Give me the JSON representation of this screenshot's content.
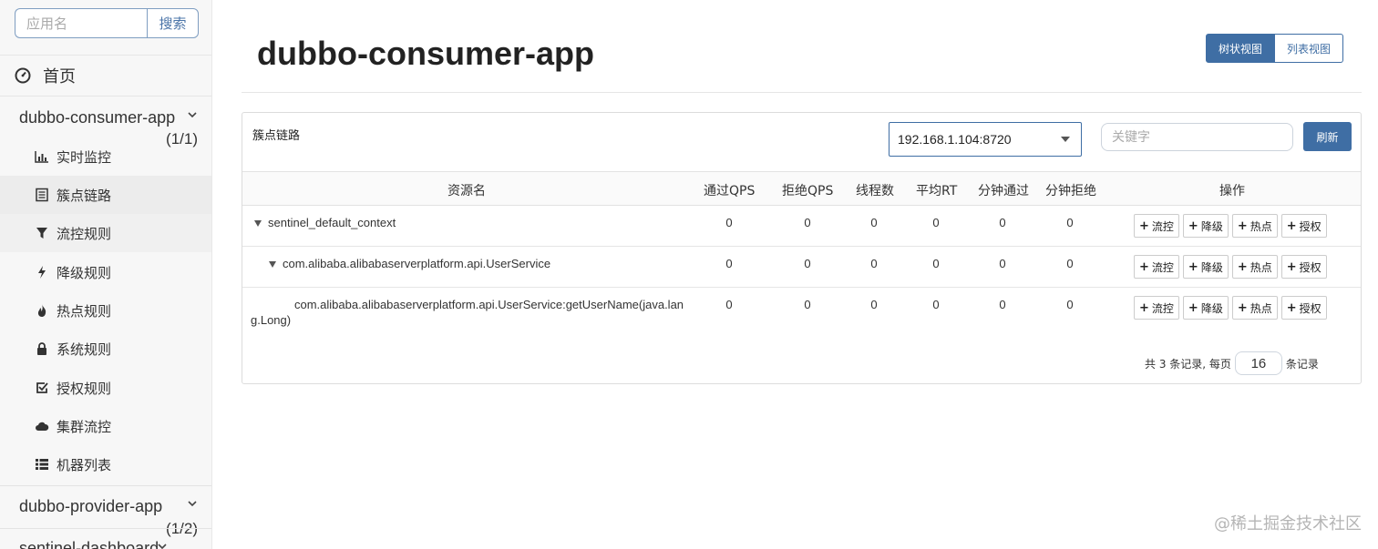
{
  "sidebar": {
    "search": {
      "placeholder": "应用名",
      "button_label": "搜索"
    },
    "home_label": "首页",
    "apps": [
      {
        "name": "dubbo-consumer-app",
        "count": "(1/1)"
      },
      {
        "name": "dubbo-provider-app",
        "count": "(1/2)"
      },
      {
        "name": "sentinel-dashboard"
      }
    ],
    "menu": [
      {
        "label": "实时监控",
        "icon": "bar-chart-icon"
      },
      {
        "label": "簇点链路",
        "icon": "list-icon"
      },
      {
        "label": "流控规则",
        "icon": "filter-icon"
      },
      {
        "label": "降级规则",
        "icon": "bolt-icon"
      },
      {
        "label": "热点规则",
        "icon": "fire-icon"
      },
      {
        "label": "系统规则",
        "icon": "lock-icon"
      },
      {
        "label": "授权规则",
        "icon": "check-icon"
      },
      {
        "label": "集群流控",
        "icon": "cloud-icon"
      },
      {
        "label": "机器列表",
        "icon": "th-list-icon"
      }
    ]
  },
  "main": {
    "title": "dubbo-consumer-app",
    "view_toggle": {
      "tree": "树状视图",
      "list": "列表视图"
    },
    "panel_label": "簇点链路",
    "machine": "192.168.1.104:8720",
    "keyword_placeholder": "关键字",
    "refresh_label": "刷新",
    "columns": [
      "资源名",
      "通过QPS",
      "拒绝QPS",
      "线程数",
      "平均RT",
      "分钟通过",
      "分钟拒绝",
      "操作"
    ],
    "rows": [
      {
        "name": "sentinel_default_context",
        "values": [
          "0",
          "0",
          "0",
          "0",
          "0",
          "0"
        ]
      },
      {
        "name": "com.alibaba.alibabaserverplatform.api.UserService",
        "values": [
          "0",
          "0",
          "0",
          "0",
          "0",
          "0"
        ]
      },
      {
        "name_line1": "com.alibaba.alibabaserverplatform.api.UserService:getUserName(java.lan",
        "name_line2": "g.Long)",
        "values": [
          "0",
          "0",
          "0",
          "0",
          "0",
          "0"
        ]
      }
    ],
    "ops": {
      "flow": "流控",
      "degrade": "降级",
      "hot": "热点",
      "auth": "授权"
    },
    "pager": {
      "prefix": "共 3 条记录, 每页",
      "page_size": "16",
      "suffix": "条记录"
    }
  },
  "watermark": "@稀土掘金技术社区",
  "colors": {
    "primary": "#3f6ea4",
    "sidebar_bg": "#f7f7f7"
  }
}
